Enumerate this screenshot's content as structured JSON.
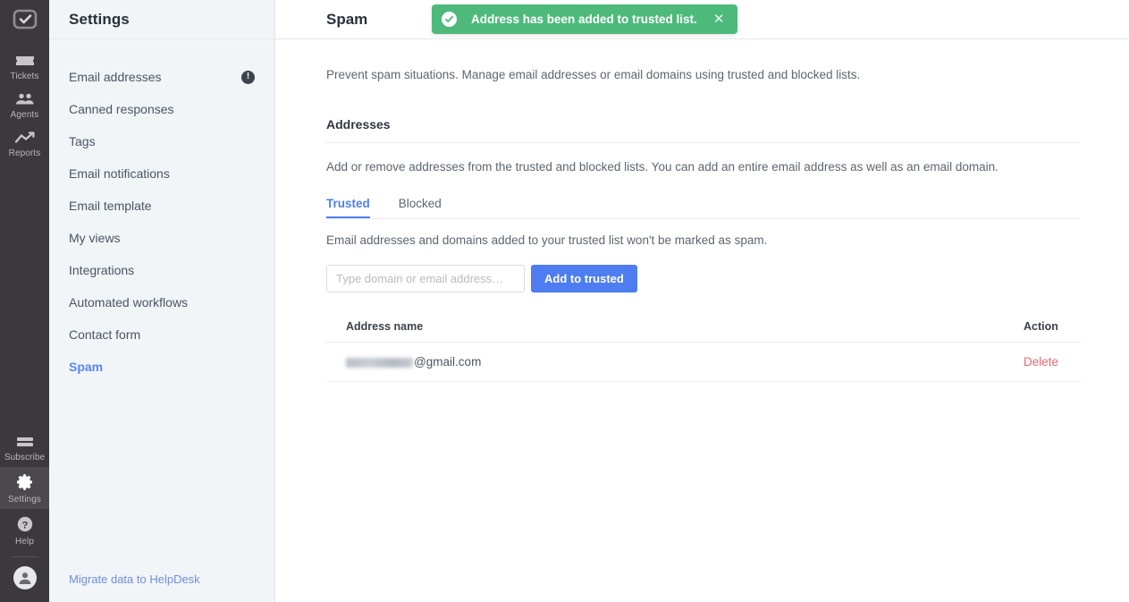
{
  "rail": {
    "logo_icon": "checkbox-logo-icon",
    "items": [
      {
        "label": "Tickets",
        "icon": "ticket-icon",
        "active": false
      },
      {
        "label": "Agents",
        "icon": "agents-icon",
        "active": false
      },
      {
        "label": "Reports",
        "icon": "reports-icon",
        "active": false
      }
    ],
    "bottom_items": [
      {
        "label": "Subscribe",
        "icon": "card-icon",
        "active": false
      },
      {
        "label": "Settings",
        "icon": "gear-icon",
        "active": true
      },
      {
        "label": "Help",
        "icon": "help-icon",
        "active": false
      }
    ],
    "avatar_icon": "user-avatar-icon"
  },
  "sidebar": {
    "title": "Settings",
    "items": [
      {
        "label": "Email addresses",
        "badge": "!",
        "active": false
      },
      {
        "label": "Canned responses",
        "badge": null,
        "active": false
      },
      {
        "label": "Tags",
        "badge": null,
        "active": false
      },
      {
        "label": "Email notifications",
        "badge": null,
        "active": false
      },
      {
        "label": "Email template",
        "badge": null,
        "active": false
      },
      {
        "label": "My views",
        "badge": null,
        "active": false
      },
      {
        "label": "Integrations",
        "badge": null,
        "active": false
      },
      {
        "label": "Automated workflows",
        "badge": null,
        "active": false
      },
      {
        "label": "Contact form",
        "badge": null,
        "active": false
      },
      {
        "label": "Spam",
        "badge": null,
        "active": true
      }
    ],
    "migrate_link": "Migrate data to HelpDesk"
  },
  "main": {
    "title": "Spam",
    "lead": "Prevent spam situations. Manage email addresses or email domains using trusted and blocked lists.",
    "section_title": "Addresses",
    "section_desc": "Add or remove addresses from the trusted and blocked lists. You can add an entire email address as well as an email domain.",
    "tabs": [
      {
        "label": "Trusted",
        "active": true
      },
      {
        "label": "Blocked",
        "active": false
      }
    ],
    "tab_desc": "Email addresses and domains added to your trusted list won't be marked as spam.",
    "input_placeholder": "Type domain or email address…",
    "input_value": "",
    "add_button": "Add to trusted",
    "table": {
      "columns": [
        "Address name",
        "Action"
      ],
      "rows": [
        {
          "redacted_prefix": "aaaaaaaaaa",
          "address": "@gmail.com",
          "action": "Delete"
        }
      ]
    }
  },
  "toast": {
    "message": "Address has been added to trusted list.",
    "icon": "check-circle-icon",
    "close_icon": "close-icon",
    "color": "#4dba7b"
  },
  "colors": {
    "accent": "#4d7df0",
    "success": "#4dba7b",
    "danger": "#e06a70",
    "rail_bg": "#3b383e",
    "sidebar_bg": "#f1f5f8"
  }
}
